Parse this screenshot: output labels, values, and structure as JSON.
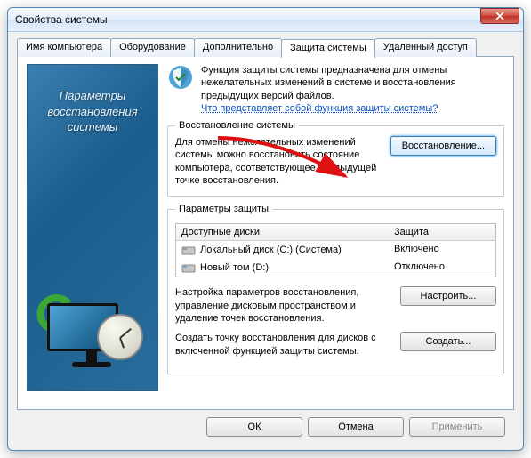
{
  "window": {
    "title": "Свойства системы"
  },
  "tabs": {
    "t1": "Имя компьютера",
    "t2": "Оборудование",
    "t3": "Дополнительно",
    "t4": "Защита системы",
    "t5": "Удаленный доступ"
  },
  "sidebar": {
    "heading_l1": "Параметры",
    "heading_l2": "восстановления",
    "heading_l3": "системы"
  },
  "intro": {
    "text": "Функция защиты системы предназначена для отмены нежелательных изменений в системе и восстановления предыдущих версий файлов.",
    "link": "Что представляет собой функция защиты системы?"
  },
  "restore_group": {
    "legend": "Восстановление системы",
    "text": "Для отмены нежелательных изменений системы можно восстановить состояние компьютера, соответствующее предыдущей точке восстановления.",
    "button": "Восстановление..."
  },
  "protect_group": {
    "legend": "Параметры защиты",
    "columns": {
      "c1": "Доступные диски",
      "c2": "Защита"
    },
    "rows": [
      {
        "name": "Локальный диск (C:) (Система)",
        "state": "Включено"
      },
      {
        "name": "Новый том (D:)",
        "state": "Отключено"
      }
    ],
    "config_text": "Настройка параметров восстановления, управление дисковым пространством и удаление точек восстановления.",
    "config_btn": "Настроить...",
    "create_text": "Создать точку восстановления для дисков с включенной функцией защиты системы.",
    "create_btn": "Создать..."
  },
  "footer": {
    "ok": "ОК",
    "cancel": "Отмена",
    "apply": "Применить"
  }
}
